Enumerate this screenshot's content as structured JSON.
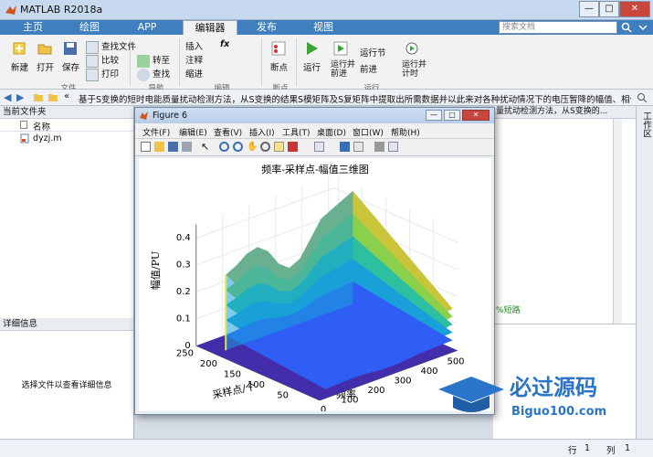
{
  "window": {
    "title": "MATLAB R2018a",
    "min": "—",
    "max": "□",
    "close": "✕"
  },
  "tabs": [
    {
      "label": "主页"
    },
    {
      "label": "绘图"
    },
    {
      "label": "APP"
    },
    {
      "label": "编辑器"
    },
    {
      "label": "发布"
    },
    {
      "label": "视图"
    }
  ],
  "search": {
    "placeholder": "搜索文档"
  },
  "ribbon": {
    "new": "新建",
    "open": "打开",
    "save": "保存",
    "find_files": "查找文件",
    "compare": "比较",
    "print": "打印",
    "goto": "转至",
    "find": "查找",
    "insert": "插入",
    "comment": "注释",
    "indent": "缩进",
    "fx": "fx",
    "breakpoints": "断点",
    "run": "运行",
    "run_advance": "运行并\n前进",
    "run_section": "运行节",
    "advance": "前进",
    "run_time": "运行并\n计时",
    "sections": [
      "文件",
      "导航",
      "编辑",
      "断点",
      "运行"
    ]
  },
  "address": {
    "text": "基于S变换的短时电能质量扰动检测方法，从S变换的结果S模矩阵及S复矩阵中提取出所需数据并以此来对各种扰动情况下的电压暂降的幅值、相位跳变、..."
  },
  "left_panel": {
    "title": "当前文件夹",
    "column": "名称",
    "file": "dyzj.m",
    "details_title": "详细信息",
    "details_hint": "选择文件以查看详细信息"
  },
  "right_panel": {
    "title_fragment": "量扰动检测方法，从S变换的...",
    "workspace_tab": "工作区",
    "code_fragment": ";%短路"
  },
  "status": {
    "row_label": "行",
    "row": "1",
    "col_label": "列",
    "col": "1"
  },
  "figure": {
    "title": "Figure 6",
    "menus": [
      "文件(F)",
      "编辑(E)",
      "查看(V)",
      "插入(I)",
      "工具(T)",
      "桌面(D)",
      "窗口(W)",
      "帮助(H)"
    ]
  },
  "chart_data": {
    "type": "surface3d",
    "title": "频率-采样点-幅值三维图",
    "xlabel": "频率",
    "ylabel": "采样点/个",
    "zlabel": "幅值/PU",
    "x_ticks": [
      0,
      100,
      200,
      300,
      400,
      500
    ],
    "y_ticks": [
      50,
      100,
      150,
      200,
      250
    ],
    "z_ticks": [
      0,
      0.1,
      0.2,
      0.3,
      0.4
    ],
    "xlim": [
      0,
      520
    ],
    "ylim": [
      0,
      260
    ],
    "zlim": [
      0,
      0.45
    ],
    "edge_profile_frequency": [
      40,
      80,
      120,
      160,
      200,
      240,
      280,
      320,
      360,
      400,
      440,
      480,
      520
    ],
    "edge_profile_amplitude": [
      0.28,
      0.3,
      0.33,
      0.34,
      0.31,
      0.25,
      0.22,
      0.24,
      0.3,
      0.36,
      0.38,
      0.4,
      0.42
    ],
    "colormap": [
      "#3e26a8",
      "#2f5ef5",
      "#1aa0d9",
      "#2cbfa0",
      "#8bd04a",
      "#c9c43a"
    ],
    "watermark": "必过源码 Biguo100.com"
  }
}
